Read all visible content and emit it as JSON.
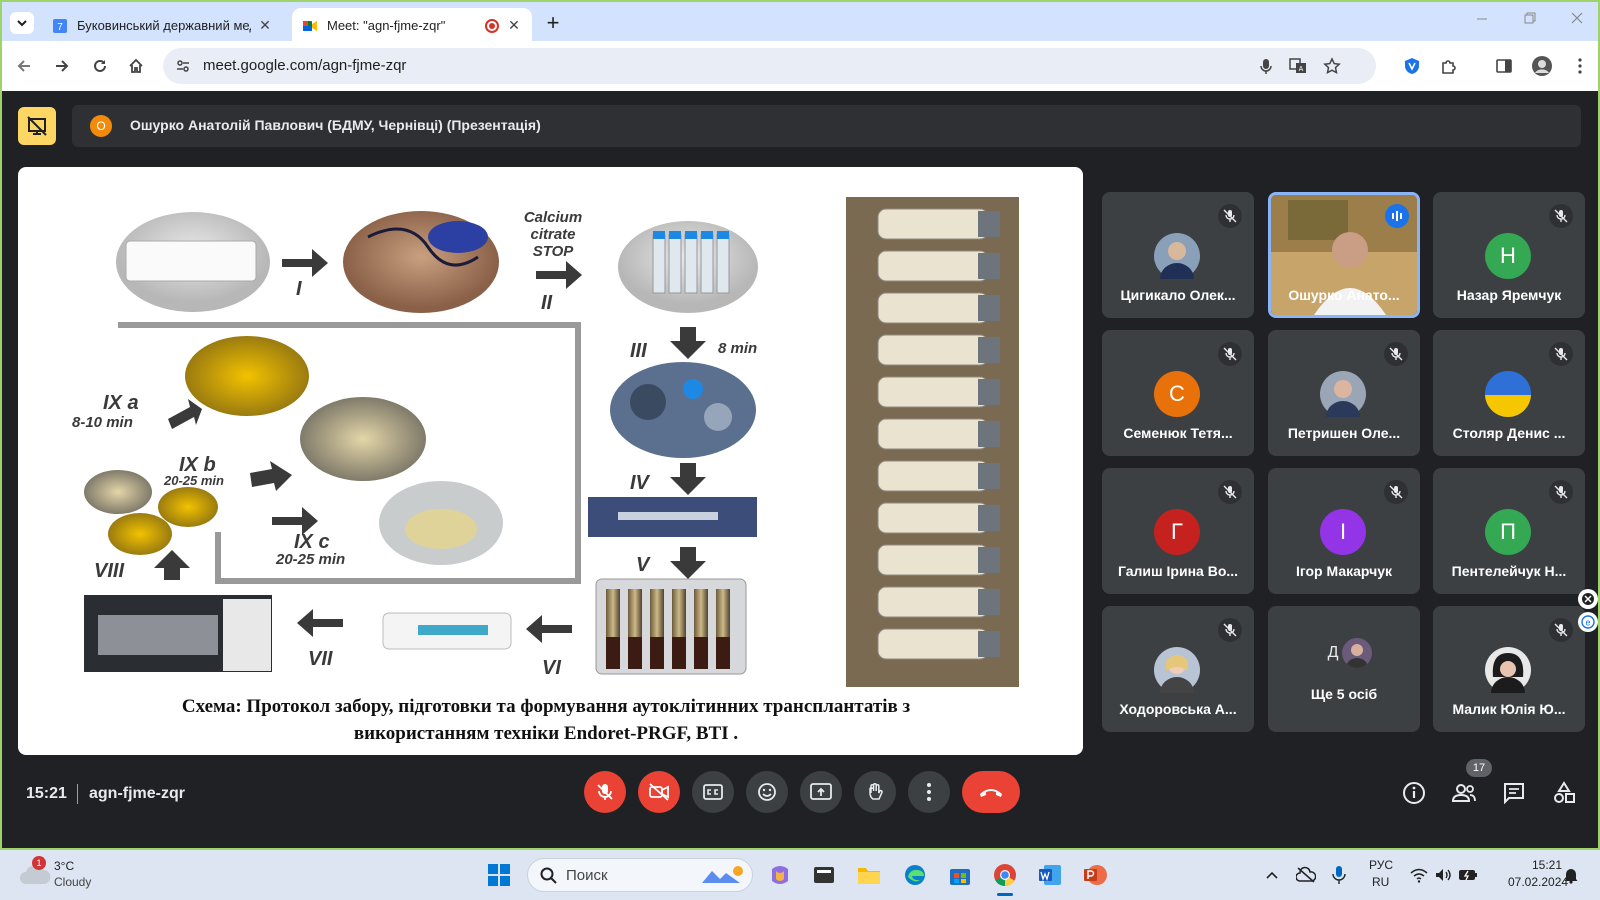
{
  "browser": {
    "tabs": [
      {
        "title": "Буковинський державний мед",
        "active": false
      },
      {
        "title": "Meet: \"agn-fjme-zqr\"",
        "active": true
      }
    ],
    "url": "meet.google.com/agn-fjme-zqr"
  },
  "meet": {
    "presenter_initial": "О",
    "presenter_title": "Ошурко Анатолій Павлович (БДМУ, Чернівці) (Презентація)",
    "slide": {
      "labels": [
        "Calcium citrate STOP",
        "I",
        "II",
        "III",
        "8 min",
        "IV",
        "V",
        "VI",
        "VII",
        "VIII",
        "IX a",
        "8-10 min",
        "IX b",
        "20-25 min",
        "IX c",
        "20-25 min"
      ],
      "caption_line1": "Схема: Протокол забору, підготовки та формування аутоклітинних трансплантатів з",
      "caption_line2": "використанням техніки Endoret-PRGF, BTI ."
    },
    "participants": [
      {
        "name": "Цигикало Олек...",
        "initial": "",
        "color": "#5f6368",
        "muted": true,
        "photo": true
      },
      {
        "name": "Ошурко Анато...",
        "initial": "",
        "color": "#5f6368",
        "muted": false,
        "speaking": true,
        "photo": true
      },
      {
        "name": "Назар Яремчук",
        "initial": "Н",
        "color": "#34a853",
        "muted": true
      },
      {
        "name": "Семенюк Тетя...",
        "initial": "С",
        "color": "#e8710a",
        "muted": true
      },
      {
        "name": "Петришен Оле...",
        "initial": "",
        "color": "#5f6368",
        "muted": true,
        "photo": true
      },
      {
        "name": "Столяр Денис ...",
        "initial": "",
        "color": "#1a73e8",
        "muted": true,
        "photo": true
      },
      {
        "name": "Галиш Ірина Во...",
        "initial": "Г",
        "color": "#c5221f",
        "muted": true
      },
      {
        "name": "Ігор Макарчук",
        "initial": "І",
        "color": "#9334e6",
        "muted": true
      },
      {
        "name": "Пентелейчук Н...",
        "initial": "П",
        "color": "#34a853",
        "muted": true
      },
      {
        "name": "Ходоровська А...",
        "initial": "",
        "color": "#5f6368",
        "muted": true,
        "photo": true
      },
      {
        "name": "Ще 5 осіб",
        "initial": "Д",
        "color": "#3c4043",
        "muted": false
      },
      {
        "name": "Малик Юлія Ю...",
        "initial": "",
        "color": "#5f6368",
        "muted": true,
        "photo": true
      }
    ],
    "time": "15:21",
    "meeting_code": "agn-fjme-zqr",
    "people_count": "17"
  },
  "taskbar": {
    "weather_temp": "3°C",
    "weather_desc": "Cloudy",
    "weather_badge": "1",
    "search_placeholder": "Поиск",
    "lang_top": "РУС",
    "lang_bottom": "RU",
    "time": "15:21",
    "date": "07.02.2024"
  }
}
